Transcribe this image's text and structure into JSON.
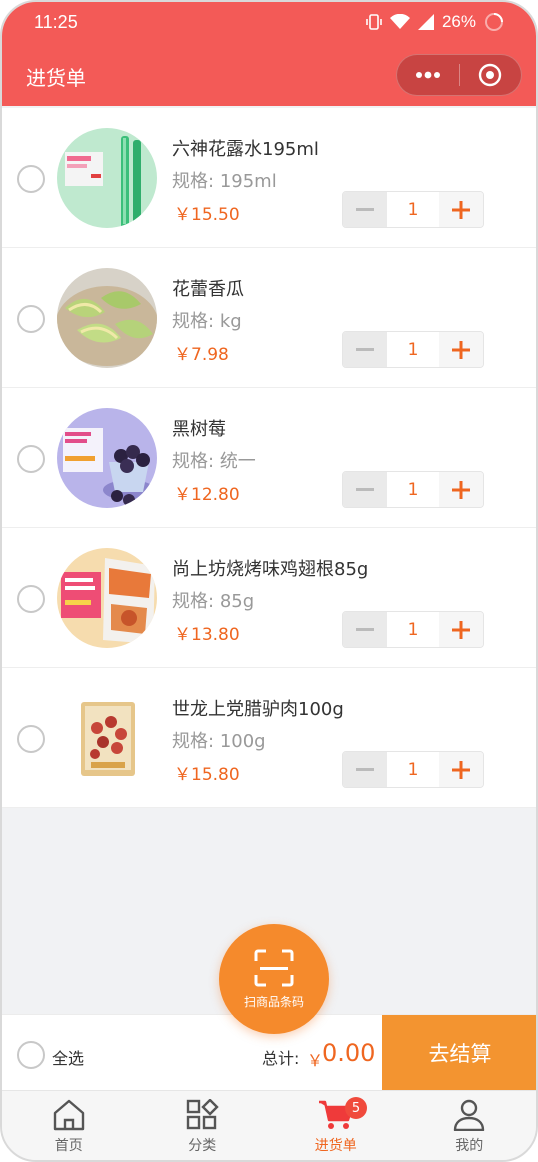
{
  "status_bar": {
    "time": "11:25",
    "battery": "26%"
  },
  "navbar": {
    "title": "进货单"
  },
  "products": [
    {
      "name": "六神花露水195ml",
      "spec_label": "规格:",
      "spec": "195ml",
      "price": "￥15.50",
      "qty": "1",
      "image": "floral-water-bottle"
    },
    {
      "name": "花蕾香瓜",
      "spec_label": "规格:",
      "spec": "kg",
      "price": "￥7.98",
      "qty": "1",
      "image": "melon-slices"
    },
    {
      "name": "黑树莓",
      "spec_label": "规格:",
      "spec": "统一",
      "price": "￥12.80",
      "qty": "1",
      "image": "blackberries"
    },
    {
      "name": "尚上坊烧烤味鸡翅根85g",
      "spec_label": "规格:",
      "spec": "85g",
      "price": "￥13.80",
      "qty": "1",
      "image": "chicken-snack-pack"
    },
    {
      "name": "世龙上党腊驴肉100g",
      "spec_label": "规格:",
      "spec": "100g",
      "price": "￥15.80",
      "qty": "1",
      "image": "donkey-meat-pack"
    }
  ],
  "scan_button": {
    "label": "扫商品条码"
  },
  "checkout": {
    "select_all": "全选",
    "total_label": "总计:",
    "currency": "￥",
    "total": "0.00",
    "button": "去结算"
  },
  "tabs": [
    {
      "label": "首页",
      "icon": "home-icon"
    },
    {
      "label": "分类",
      "icon": "category-icon"
    },
    {
      "label": "进货单",
      "icon": "cart-icon",
      "badge": "5",
      "active": true
    },
    {
      "label": "我的",
      "icon": "user-icon"
    }
  ],
  "colors": {
    "brand": "#f35a57",
    "accent": "#ef6620",
    "checkout": "#f39430"
  }
}
